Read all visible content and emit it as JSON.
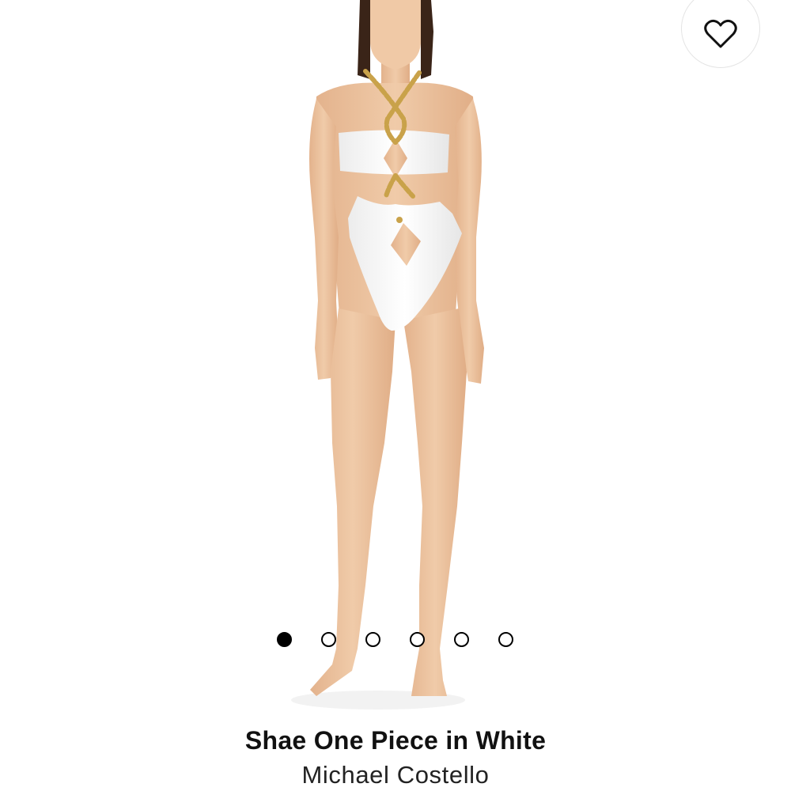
{
  "product": {
    "title": "Shae One Piece in White",
    "brand": "Michael Costello",
    "image_alt": "model-wearing-white-cutout-one-piece-swimsuit-with-gold-chain-halter"
  },
  "wishlist": {
    "icon": "heart-icon"
  },
  "carousel": {
    "total": 6,
    "active_index": 0
  },
  "colors": {
    "skin": "#ecc4a1",
    "suit": "#ffffff",
    "chain": "#c9a24a",
    "hair": "#3a2418",
    "dot": "#000000"
  }
}
